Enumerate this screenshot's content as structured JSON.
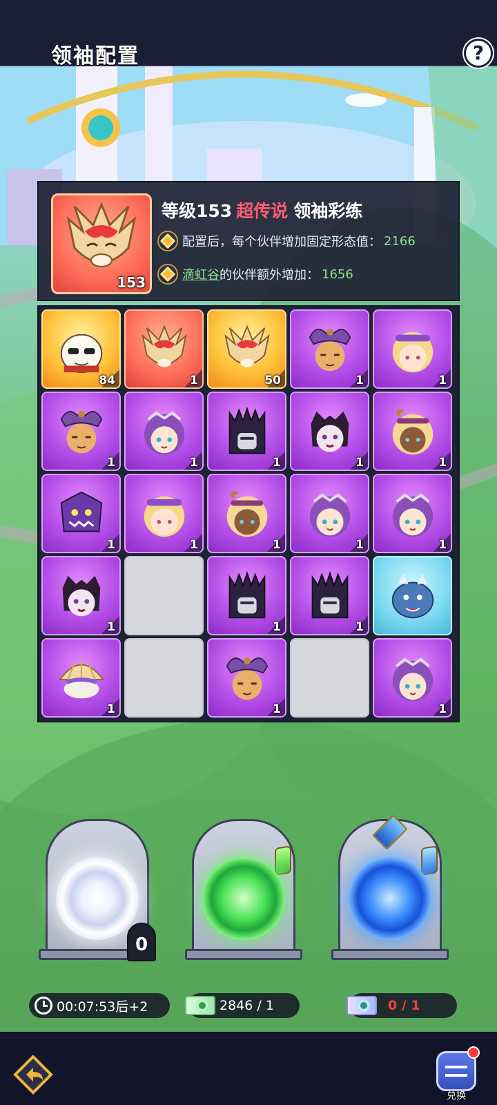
{
  "header": {
    "title": "领袖配置",
    "help_label": "?"
  },
  "leader": {
    "level_label": "等级153",
    "rarity": "超传说",
    "name": "领袖彩练",
    "level_badge": "153",
    "bonus_text": "配置后，每个伙伴增加固定形态值：",
    "bonus_value": "2166",
    "extra_link": "滴虹谷",
    "extra_text": "的伙伴额外增加：",
    "extra_value": "1656"
  },
  "grid": {
    "tiles": [
      {
        "rarity": "orange",
        "icon": "panda-sunglasses-icon",
        "count": "84"
      },
      {
        "rarity": "red",
        "icon": "dragon-mask-icon",
        "count": "1"
      },
      {
        "rarity": "orange",
        "icon": "dragon-mask-icon",
        "count": "50"
      },
      {
        "rarity": "purple",
        "icon": "horned-helmet-icon",
        "count": "1"
      },
      {
        "rarity": "purple",
        "icon": "blonde-girl-icon",
        "count": "1"
      },
      {
        "rarity": "purple",
        "icon": "horned-helmet-icon",
        "count": "1"
      },
      {
        "rarity": "purple",
        "icon": "purple-hair-girl-icon",
        "count": "1"
      },
      {
        "rarity": "purple",
        "icon": "dark-crown-knight-icon",
        "count": "1"
      },
      {
        "rarity": "purple",
        "icon": "gothic-girl-icon",
        "count": "1"
      },
      {
        "rarity": "purple",
        "icon": "horned-blonde-icon",
        "count": "1"
      },
      {
        "rarity": "purple",
        "icon": "purple-monster-icon",
        "count": "1"
      },
      {
        "rarity": "purple",
        "icon": "blonde-girl-icon",
        "count": "1"
      },
      {
        "rarity": "purple",
        "icon": "horned-blonde-icon",
        "count": "1"
      },
      {
        "rarity": "purple",
        "icon": "purple-hair-girl-icon",
        "count": "1"
      },
      {
        "rarity": "purple",
        "icon": "purple-hair-girl-icon",
        "count": "1"
      },
      {
        "rarity": "purple",
        "icon": "gothic-girl-icon",
        "count": "1"
      },
      {
        "rarity": "empty",
        "icon": "",
        "count": ""
      },
      {
        "rarity": "purple",
        "icon": "dark-crown-knight-icon",
        "count": "1"
      },
      {
        "rarity": "purple",
        "icon": "dark-crown-knight-icon",
        "count": "1"
      },
      {
        "rarity": "blue",
        "icon": "blue-dragon-icon",
        "count": ""
      },
      {
        "rarity": "purple",
        "icon": "shell-creature-icon",
        "count": "1"
      },
      {
        "rarity": "empty",
        "icon": "",
        "count": ""
      },
      {
        "rarity": "purple",
        "icon": "horned-helmet-icon",
        "count": "1"
      },
      {
        "rarity": "empty",
        "icon": "",
        "count": ""
      },
      {
        "rarity": "purple",
        "icon": "purple-hair-girl-icon",
        "count": "1"
      }
    ]
  },
  "portals": {
    "white_count": "0",
    "timer": "00:07:53后+2",
    "green_tickets": "2846 / 1",
    "blue_tickets": "0 / 1"
  },
  "footer": {
    "exchange_label": "兑换"
  },
  "colors": {
    "accent_red": "#ff5d73",
    "value_green": "#8fe08a"
  }
}
